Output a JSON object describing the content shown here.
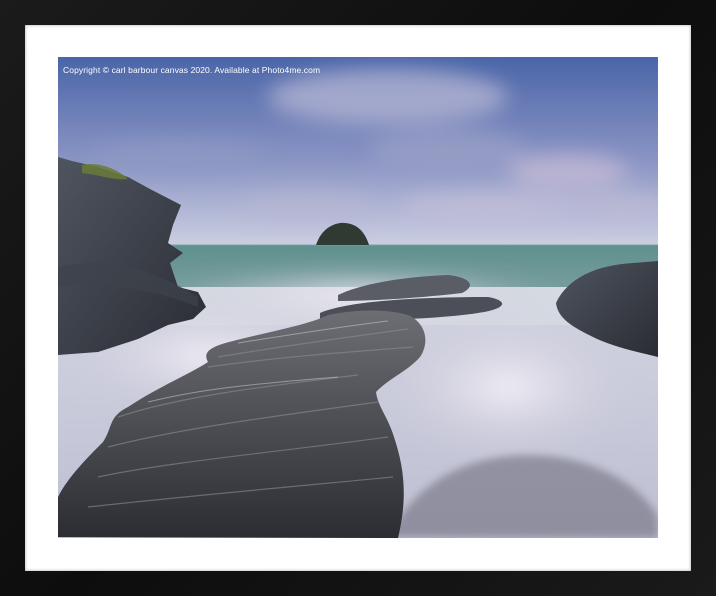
{
  "photo": {
    "copyright_text": "Copyright © carl barbour canvas 2020. Available at Photo4me.com",
    "scene": "seascape-rocks-misty-water"
  },
  "colors": {
    "frame": "#111111",
    "mount": "#ffffff",
    "sky_top": "#4a65a8",
    "sky_bottom": "#c9cde0",
    "sea": "#5e8d8b",
    "rock": "#3a3d42"
  }
}
